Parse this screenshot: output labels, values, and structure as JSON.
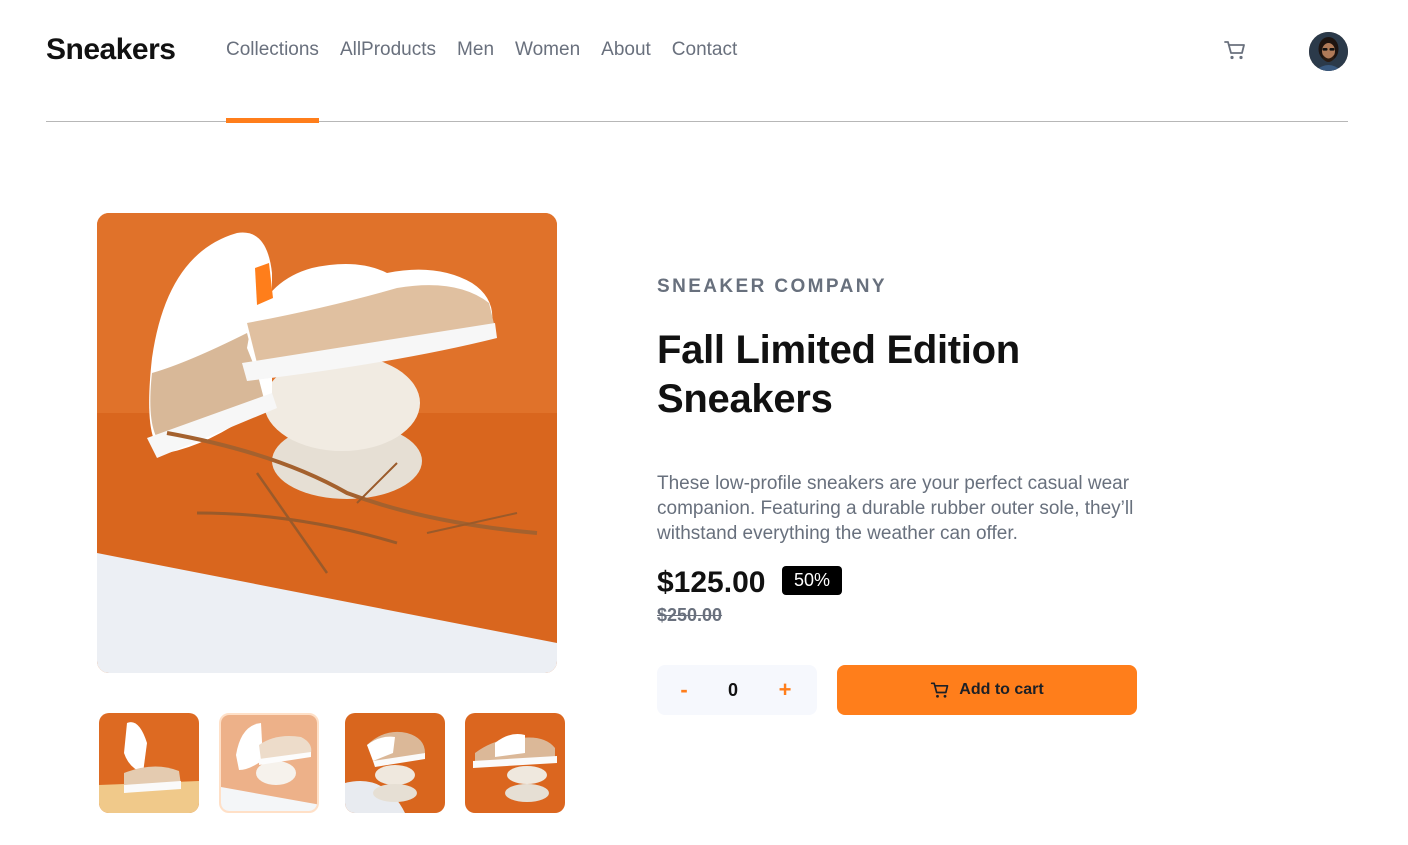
{
  "header": {
    "logo": "Sneakers",
    "nav": [
      "Collections",
      "AllProducts",
      "Men",
      "Women",
      "About",
      "Contact"
    ],
    "active_nav_index": 0
  },
  "icons": {
    "cart": "cart-icon",
    "avatar": "user-avatar"
  },
  "colors": {
    "accent": "#ff7e1b",
    "text_muted": "#68707d",
    "badge_bg": "#000000",
    "qty_bg": "#f6f8fd"
  },
  "gallery": {
    "active_thumbnail_index": 1,
    "thumbnail_count": 4
  },
  "product": {
    "company": "SNEAKER COMPANY",
    "title": "Fall Limited Edition Sneakers",
    "description": "These low-profile sneakers are your perfect casual wear companion. Featuring a durable rubber outer sole, they’ll withstand everything the weather can offer.",
    "price": "$125.00",
    "discount": "50%",
    "old_price": "$250.00"
  },
  "cart_controls": {
    "minus": "-",
    "quantity": "0",
    "plus": "+",
    "add_label": "Add to cart"
  }
}
